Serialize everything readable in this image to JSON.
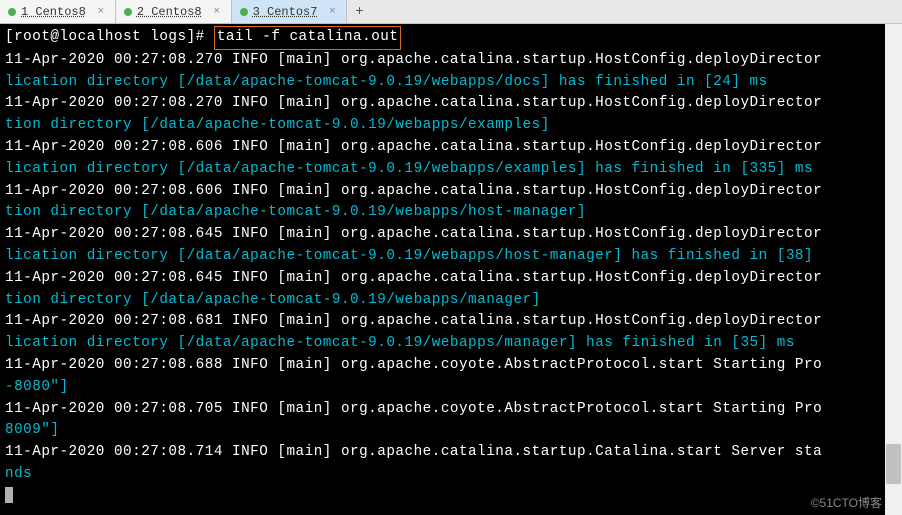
{
  "tabs": [
    {
      "label": "1 Centos8"
    },
    {
      "label": "2 Centos8"
    },
    {
      "label": "3 Centos7"
    }
  ],
  "prompt": "[root@localhost logs]# ",
  "command": "tail -f catalina.out",
  "lines": [
    {
      "t": "11-Apr-2020 00:27:08.270 INFO [main] org.apache.catalina.startup.HostConfig.deployDirector",
      "c": "log-line"
    },
    {
      "t": "lication directory [/data/apache-tomcat-9.0.19/webapps/docs] has finished in [24] ms",
      "c": "cyan"
    },
    {
      "t": "11-Apr-2020 00:27:08.270 INFO [main] org.apache.catalina.startup.HostConfig.deployDirector",
      "c": "log-line"
    },
    {
      "t": "tion directory [/data/apache-tomcat-9.0.19/webapps/examples]",
      "c": "cyan"
    },
    {
      "t": "11-Apr-2020 00:27:08.606 INFO [main] org.apache.catalina.startup.HostConfig.deployDirector",
      "c": "log-line"
    },
    {
      "t": "lication directory [/data/apache-tomcat-9.0.19/webapps/examples] has finished in [335] ms",
      "c": "cyan"
    },
    {
      "t": "11-Apr-2020 00:27:08.606 INFO [main] org.apache.catalina.startup.HostConfig.deployDirector",
      "c": "log-line"
    },
    {
      "t": "tion directory [/data/apache-tomcat-9.0.19/webapps/host-manager]",
      "c": "cyan"
    },
    {
      "t": "11-Apr-2020 00:27:08.645 INFO [main] org.apache.catalina.startup.HostConfig.deployDirector",
      "c": "log-line"
    },
    {
      "t": "lication directory [/data/apache-tomcat-9.0.19/webapps/host-manager] has finished in [38] ",
      "c": "cyan"
    },
    {
      "t": "11-Apr-2020 00:27:08.645 INFO [main] org.apache.catalina.startup.HostConfig.deployDirector",
      "c": "log-line"
    },
    {
      "t": "tion directory [/data/apache-tomcat-9.0.19/webapps/manager]",
      "c": "cyan"
    },
    {
      "t": "11-Apr-2020 00:27:08.681 INFO [main] org.apache.catalina.startup.HostConfig.deployDirector",
      "c": "log-line"
    },
    {
      "t": "lication directory [/data/apache-tomcat-9.0.19/webapps/manager] has finished in [35] ms",
      "c": "cyan"
    },
    {
      "t": "11-Apr-2020 00:27:08.688 INFO [main] org.apache.coyote.AbstractProtocol.start Starting Pro",
      "c": "log-line"
    },
    {
      "t": "-8080\"]",
      "c": "cyan"
    },
    {
      "t": "11-Apr-2020 00:27:08.705 INFO [main] org.apache.coyote.AbstractProtocol.start Starting Pro",
      "c": "log-line"
    },
    {
      "t": "8009\"]",
      "c": "cyan"
    },
    {
      "t": "11-Apr-2020 00:27:08.714 INFO [main] org.apache.catalina.startup.Catalina.start Server sta",
      "c": "log-line"
    },
    {
      "t": "nds",
      "c": "cyan"
    }
  ],
  "watermark": "©51CTO博客"
}
